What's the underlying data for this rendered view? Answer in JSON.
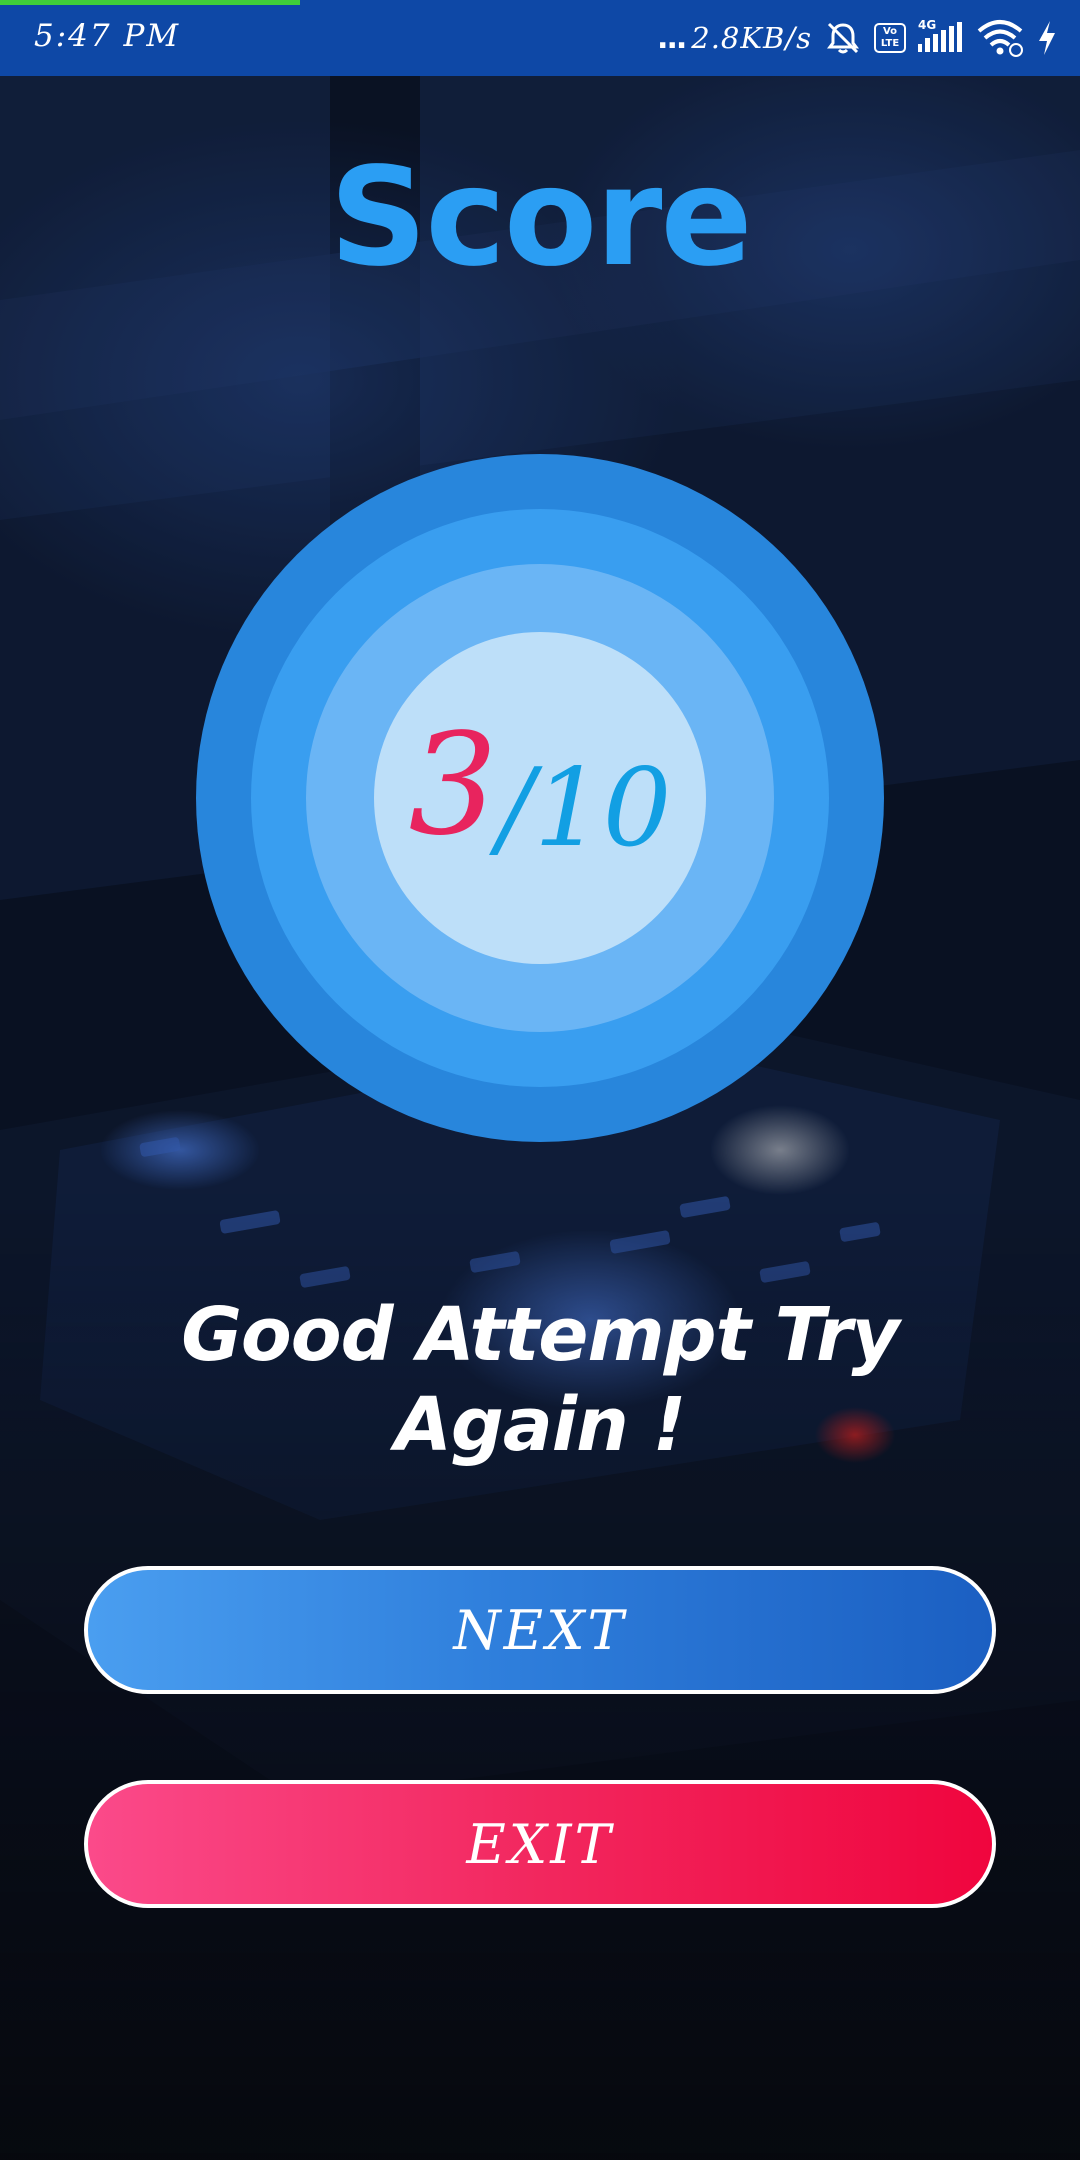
{
  "status_bar": {
    "time": "5:47 PM",
    "dots": "...",
    "net_speed": "2.8KB/s",
    "volte_line1": "Vo",
    "volte_line2": "LTE",
    "network_type": "4G",
    "icons": [
      "muted-alarm-icon",
      "volte-icon",
      "signal-icon",
      "wifi-icon",
      "charging-bolt-icon"
    ]
  },
  "title": "Score",
  "score": {
    "correct": "3",
    "separator": "/",
    "total": "10"
  },
  "message": "Good Attempt Try Again !",
  "buttons": {
    "next_label": "NEXT",
    "exit_label": "EXIT"
  },
  "colors": {
    "status_bar_bg": "#0e48a6",
    "title": "#2b9ef3",
    "score_correct": "#e8245e",
    "score_total": "#129fe3",
    "next_button": "#2f7fdc",
    "exit_button": "#f2275e"
  }
}
